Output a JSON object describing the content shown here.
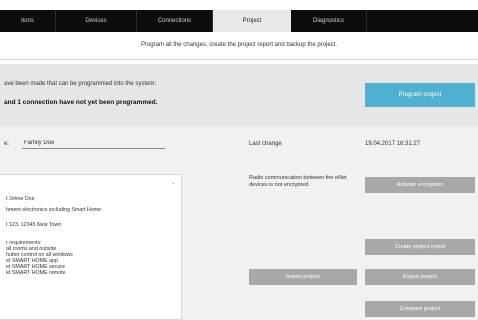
{
  "nav": {
    "tabs": [
      {
        "label": "tions"
      },
      {
        "label": "Devices"
      },
      {
        "label": "Connections"
      },
      {
        "label": "Project"
      },
      {
        "label": "Diagnostics"
      }
    ],
    "active_tab": "Project"
  },
  "header": {
    "subtitle": "Program all the changes, create the project report and backup the project."
  },
  "status": {
    "line1": "ave been made that can be programmed into the system:",
    "line2": "and 1 connection have not yet been programmed.",
    "program_button": "Program project"
  },
  "project": {
    "name_label": "e:",
    "name_value": "Family Doe",
    "last_change_label": "Last change",
    "last_change_value": "19.04.2017 16:31:27",
    "radio_warning": "Radio communication between the eNet devices is not encrypted.",
    "description_lines": [
      "t Johne Doe",
      "hment electronics including Smart Home",
      "t 123, 12345 New Town",
      "r requirements:",
      "all rooms and outside",
      "hutter control on all windows",
      "et SMART HOME app",
      "et SMART HOME secure",
      "et SMART HOME remote"
    ]
  },
  "buttons": {
    "activate_encryption": "Activate encryption",
    "create_report": "Create project report",
    "import_project": "Import project",
    "export_project": "Export project",
    "compare_project": "Compare project"
  },
  "colors": {
    "nav_bg": "#0d0d0d",
    "active_tab_bg": "#e9e9e9",
    "accent": "#4fb0d0",
    "disabled_button": "#a8a8a8"
  }
}
